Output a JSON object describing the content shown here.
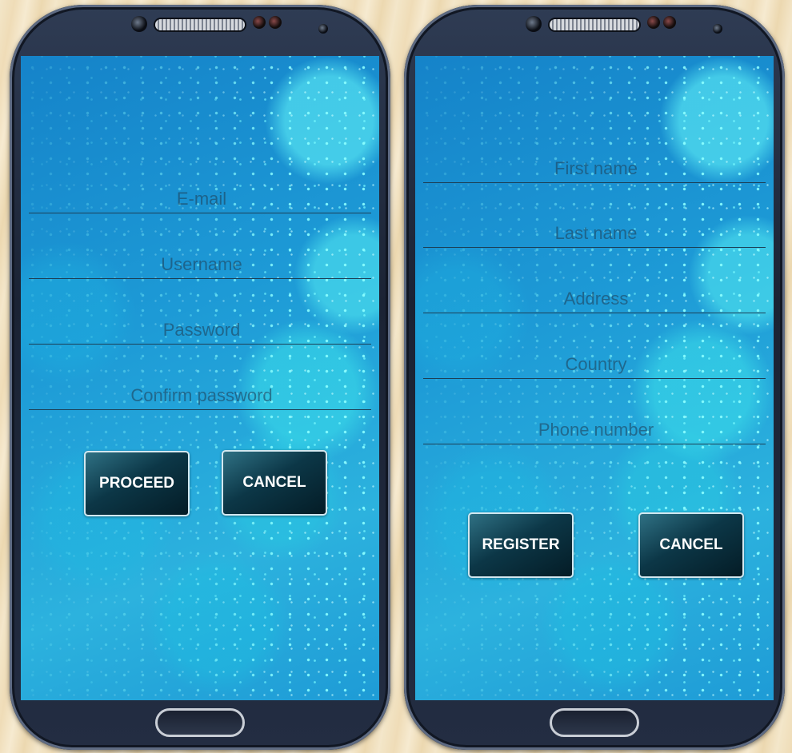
{
  "login_screen": {
    "fields": [
      {
        "placeholder": "E-mail"
      },
      {
        "placeholder": "Username"
      },
      {
        "placeholder": "Password"
      },
      {
        "placeholder": "Confirm password"
      }
    ],
    "proceed_label": "PROCEED",
    "cancel_label": "CANCEL"
  },
  "register_screen": {
    "fields": [
      {
        "placeholder": "First name"
      },
      {
        "placeholder": "Last name"
      },
      {
        "placeholder": "Address"
      },
      {
        "placeholder": "Country"
      },
      {
        "placeholder": "Phone number"
      }
    ],
    "register_label": "REGISTER",
    "cancel_label": "CANCEL"
  },
  "colors": {
    "button_bg": "#0c3747",
    "screen_bg": "#1d9ad6",
    "field_line": "#1c3f56"
  }
}
